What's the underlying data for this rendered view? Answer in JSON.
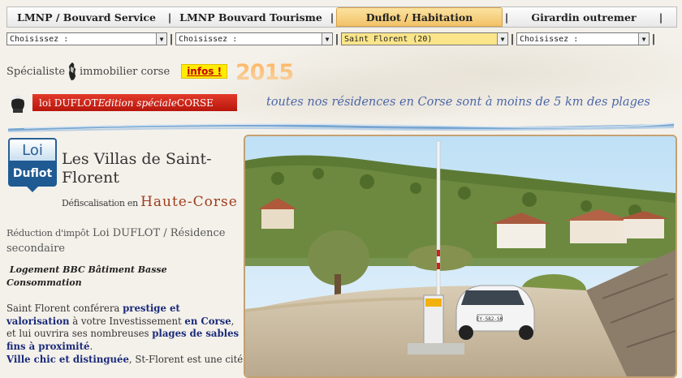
{
  "nav": {
    "tabs": [
      {
        "label": "LMNP / Bouvard Service"
      },
      {
        "label": "LMNP Bouvard Tourisme"
      },
      {
        "label": "Duflot / Habitation"
      },
      {
        "label": "Girardin outremer"
      }
    ],
    "separator": "|"
  },
  "selects": [
    {
      "value": "Choisissez :"
    },
    {
      "value": "Choisissez :"
    },
    {
      "value": "Saint Florent (20)"
    },
    {
      "value": "Choisissez :"
    }
  ],
  "specialist": {
    "before": "Spécialiste",
    "after": "immobilier corse",
    "infos_label": "infos !",
    "year": "2015"
  },
  "banner": {
    "prefix": "loi DUFLOT",
    "italic": " Edition spéciale ",
    "suffix": "CORSE"
  },
  "slogan": "toutes nos résidences en Corse sont à moins de 5 km des plages",
  "badge": {
    "top": "Loi",
    "bottom": "Duflot"
  },
  "residence": {
    "title": "Les Villas de Saint-Florent",
    "defisc_label": "Défiscalisation en ",
    "region": "Haute-Corse"
  },
  "reduction": {
    "small": "Réduction d'impôt",
    "rest": " Loi DUFLOT / Résidence secondaire"
  },
  "bbc": "Logement BBC Bâtiment Basse Consommation",
  "description": {
    "p1": "Saint Florent conférera ",
    "b1": "prestige et valorisation",
    "p2": " à votre Investissement ",
    "b2": "en Corse",
    "p3": ", et lui ouvrira ses nombreuses ",
    "b3": "plages de sables fins à proximité",
    "p4": ".",
    "b4": "Ville chic et distinguée",
    "p5": ", St-Florent est une cité"
  },
  "photo": {
    "plate": "EY-582-SH"
  },
  "colors": {
    "accent": "#f2c268",
    "banner_red": "#c8180f",
    "slogan_blue": "#4c66a8",
    "region_brown": "#9e3b1b"
  }
}
